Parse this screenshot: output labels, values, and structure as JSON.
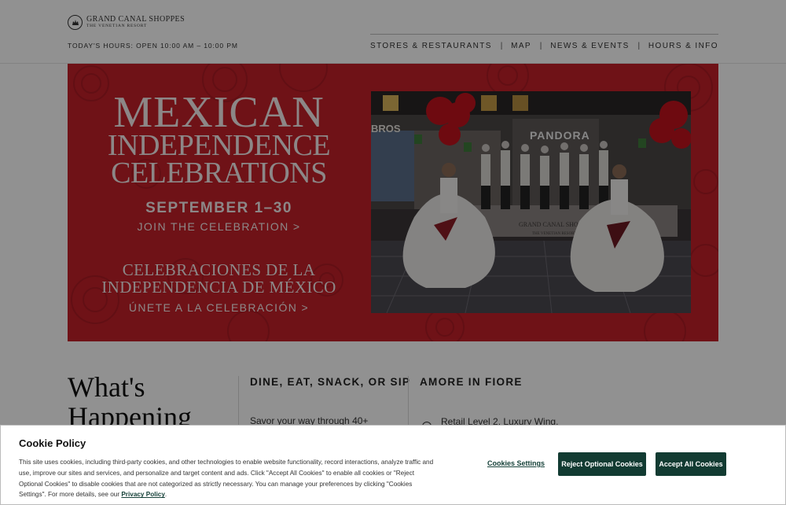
{
  "header": {
    "logo_line1": "GRAND CANAL SHOPPES",
    "logo_line2": "THE VENETIAN RESORT",
    "hours": "TODAY'S HOURS: OPEN 10:00 AM – 10:00 PM",
    "nav": [
      {
        "label": "STORES & RESTAURANTS"
      },
      {
        "label": "MAP"
      },
      {
        "label": "NEWS & EVENTS"
      },
      {
        "label": "HOURS & INFO"
      }
    ],
    "nav_separator": "|"
  },
  "hero": {
    "title_line1": "MEXICAN",
    "title_line2": "INDEPENDENCE",
    "title_line3": "CELEBRATIONS",
    "date": "SEPTEMBER 1–30",
    "cta": "JOIN THE CELEBRATION >",
    "es_line1": "CELEBRACIONES DE LA",
    "es_line2": "INDEPENDENCIA DE MÉXICO",
    "es_cta": "ÚNETE A LA CELEBRACIÓN >",
    "photo_sign1": "BROS",
    "photo_sign2": "PANDORA",
    "photo_stage_text": "GRAND CANAL SHOPPES",
    "photo_stage_sub": "THE VENETIAN RESORT",
    "accent_color": "#c3202a"
  },
  "whats_happening": {
    "title_line1": "What's",
    "title_line2": "Happening",
    "col1_head": "DINE, EAT, SNACK, OR SIP",
    "col1_text": "Savor your way through 40+",
    "col2_head": "AMORE IN FIORE",
    "col2_text": "Retail Level 2, Luxury Wing,"
  },
  "cookie": {
    "title": "Cookie Policy",
    "text": "This site uses cookies, including third-party cookies, and other technologies to enable website functionality, record interactions, analyze traffic and use, improve our sites and services, and personalize and target content and ads. Click \"Accept All Cookies\" to enable all cookies or \"Reject Optional Cookies\" to disable cookies that are not categorized as strictly necessary. You can manage your preferences by clicking \"Cookies Settings\". For more details, see our",
    "privacy_link": "Privacy Policy",
    "period": ".",
    "settings_label": "Cookies Settings",
    "reject_label": "Reject Optional Cookies",
    "accept_label": "Accept All Cookies",
    "button_color": "#123b32"
  }
}
